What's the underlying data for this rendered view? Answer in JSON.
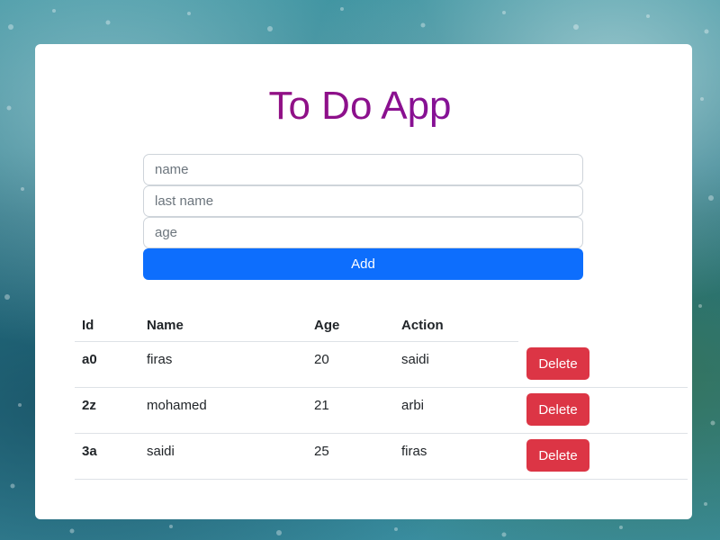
{
  "app": {
    "title": "To Do App"
  },
  "form": {
    "name_placeholder": "name",
    "lastname_placeholder": "last name",
    "age_placeholder": "age",
    "add_label": "Add"
  },
  "table": {
    "headers": {
      "id": "Id",
      "name": "Name",
      "age": "Age",
      "action": "Action"
    },
    "rows": [
      {
        "id": "a0",
        "name": "firas",
        "age": "20",
        "action": "saidi",
        "delete_label": "Delete"
      },
      {
        "id": "2z",
        "name": "mohamed",
        "age": "21",
        "action": "arbi",
        "delete_label": "Delete"
      },
      {
        "id": "3a",
        "name": "saidi",
        "age": "25",
        "action": "firas",
        "delete_label": "Delete"
      }
    ]
  },
  "colors": {
    "primary": "#0d6efd",
    "danger": "#dc3545",
    "title_gradient_start": "#a0106a",
    "title_gradient_end": "#6a1ab8"
  }
}
